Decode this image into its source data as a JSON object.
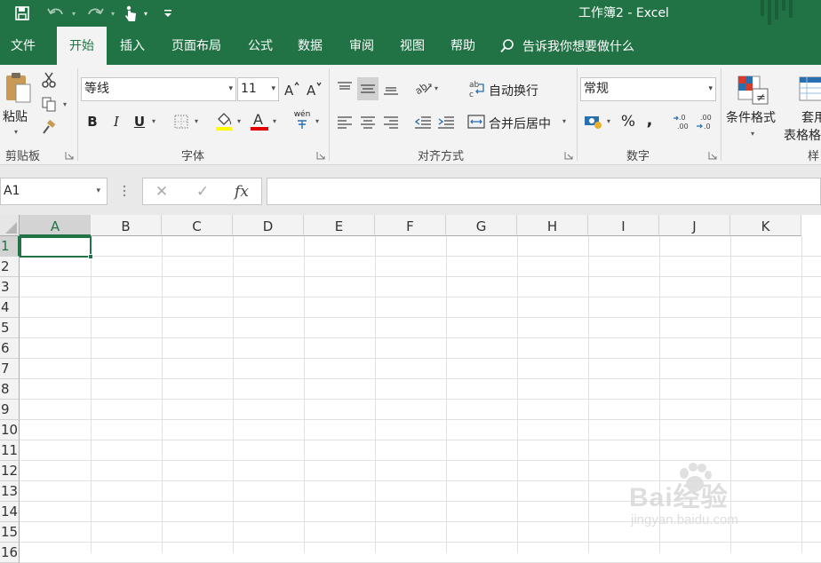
{
  "app": {
    "title": "工作簿2  -  Excel",
    "accent": "#217346"
  },
  "quick_access": [
    {
      "icon": "save-icon"
    },
    {
      "icon": "undo-icon"
    },
    {
      "icon": "redo-icon"
    },
    {
      "icon": "touch-mode-icon"
    },
    {
      "icon": "customize-qat-icon"
    }
  ],
  "tabs": [
    {
      "label": "文件",
      "active": false
    },
    {
      "label": "开始",
      "active": true
    },
    {
      "label": "插入",
      "active": false
    },
    {
      "label": "页面布局",
      "active": false
    },
    {
      "label": "公式",
      "active": false
    },
    {
      "label": "数据",
      "active": false
    },
    {
      "label": "审阅",
      "active": false
    },
    {
      "label": "视图",
      "active": false
    },
    {
      "label": "帮助",
      "active": false
    }
  ],
  "tell_me": {
    "placeholder": "告诉我你想要做什么"
  },
  "ribbon": {
    "clipboard": {
      "group_label": "剪贴板",
      "paste_label": "粘贴"
    },
    "font": {
      "group_label": "字体",
      "font_name": "等线",
      "font_size": "11",
      "bold": "B",
      "italic": "I",
      "underline": "U",
      "font_color_glyph": "A",
      "phonetic_glyph": "wén",
      "highlight_color": "#ffff00",
      "font_color": "#e00000"
    },
    "alignment": {
      "group_label": "对齐方式",
      "wrap_text": "自动换行",
      "merge_center": "合并后居中"
    },
    "number": {
      "group_label": "数字",
      "format": "常规",
      "percent": "%",
      "comma": ","
    },
    "styles": {
      "group_label": "样",
      "conditional_formatting": "条件格式",
      "format_as_table_1": "套用",
      "format_as_table_2": "表格格"
    }
  },
  "formula_bar": {
    "name_box": "A1",
    "cancel": "✕",
    "enter": "✓",
    "fx": "fx",
    "formula": ""
  },
  "sheet": {
    "columns": [
      "A",
      "B",
      "C",
      "D",
      "E",
      "F",
      "G",
      "H",
      "I",
      "J",
      "K"
    ],
    "rows": [
      "1",
      "2",
      "3",
      "4",
      "5",
      "6",
      "7",
      "8",
      "9",
      "10",
      "11",
      "12",
      "13",
      "14",
      "15",
      "16"
    ],
    "active_cell": "A1"
  },
  "watermark": {
    "brand": "Bai经验",
    "url": "jingyan.baidu.com"
  }
}
